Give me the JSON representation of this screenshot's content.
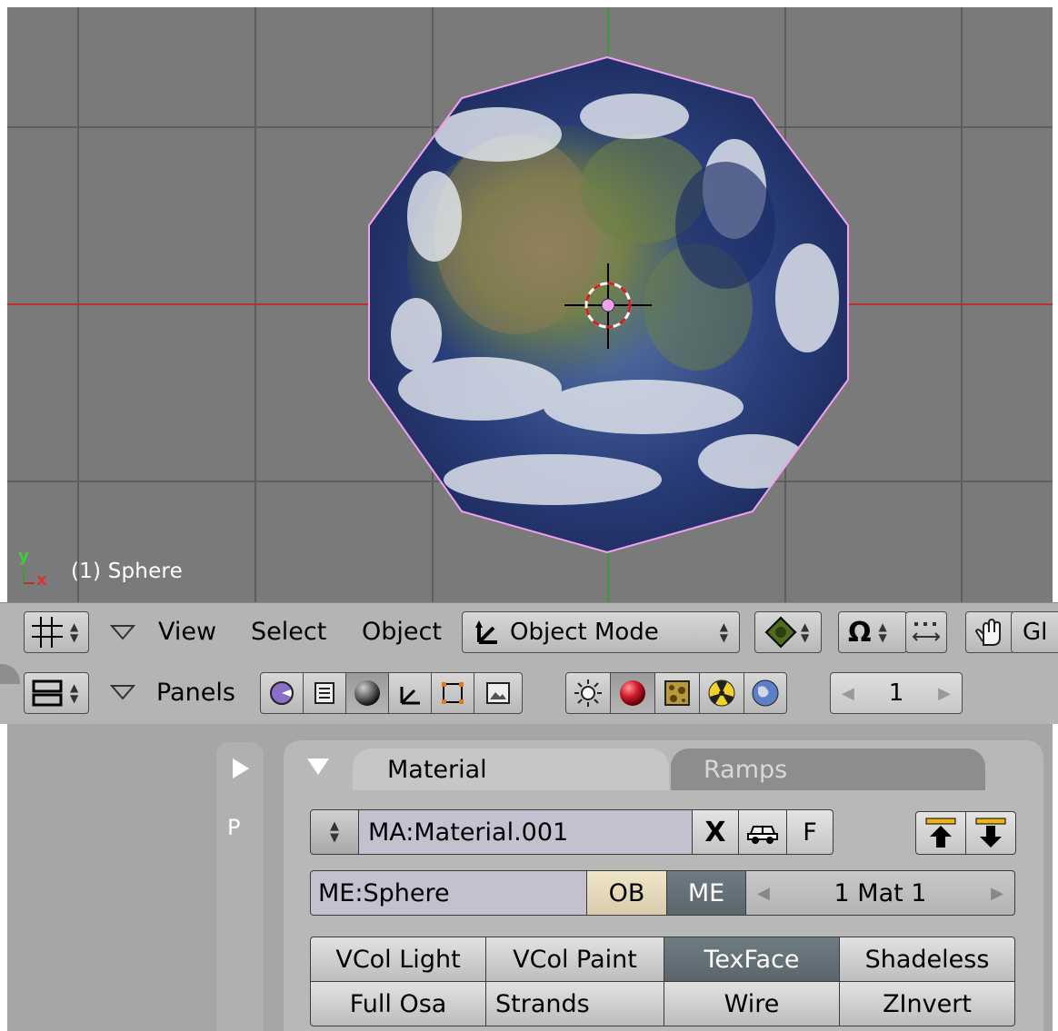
{
  "viewport": {
    "object_label": "(1) Sphere",
    "axis_y": "y",
    "axis_x": "x"
  },
  "header": {
    "menu_view": "View",
    "menu_select": "Select",
    "menu_object": "Object",
    "mode": "Object Mode",
    "global_label": "Gl"
  },
  "buttons_header": {
    "panels_label": "Panels",
    "frame_value": "1"
  },
  "material_panel": {
    "tab_material": "Material",
    "tab_ramps": "Ramps",
    "side_p": "P",
    "material_name": "MA:Material.001",
    "x_label": "X",
    "f_label": "F",
    "mesh_name": "ME:Sphere",
    "ob_label": "OB",
    "me_label": "ME",
    "mat_index": "1 Mat 1",
    "toggles_row1": [
      "VCol Light",
      "VCol Paint",
      "TexFace",
      "Shadeless"
    ],
    "toggles_row2": [
      "Full Osa",
      "Strands",
      "Wire",
      "ZInvert"
    ]
  },
  "colors": {
    "viewport_bg": "#7a7a7a",
    "grid": "#5e5e5e",
    "x_axis": "#b43232",
    "y_axis": "#3d9a3d",
    "selection_outline": "#f0a0f0",
    "toggle_on": "#5f6a71"
  }
}
